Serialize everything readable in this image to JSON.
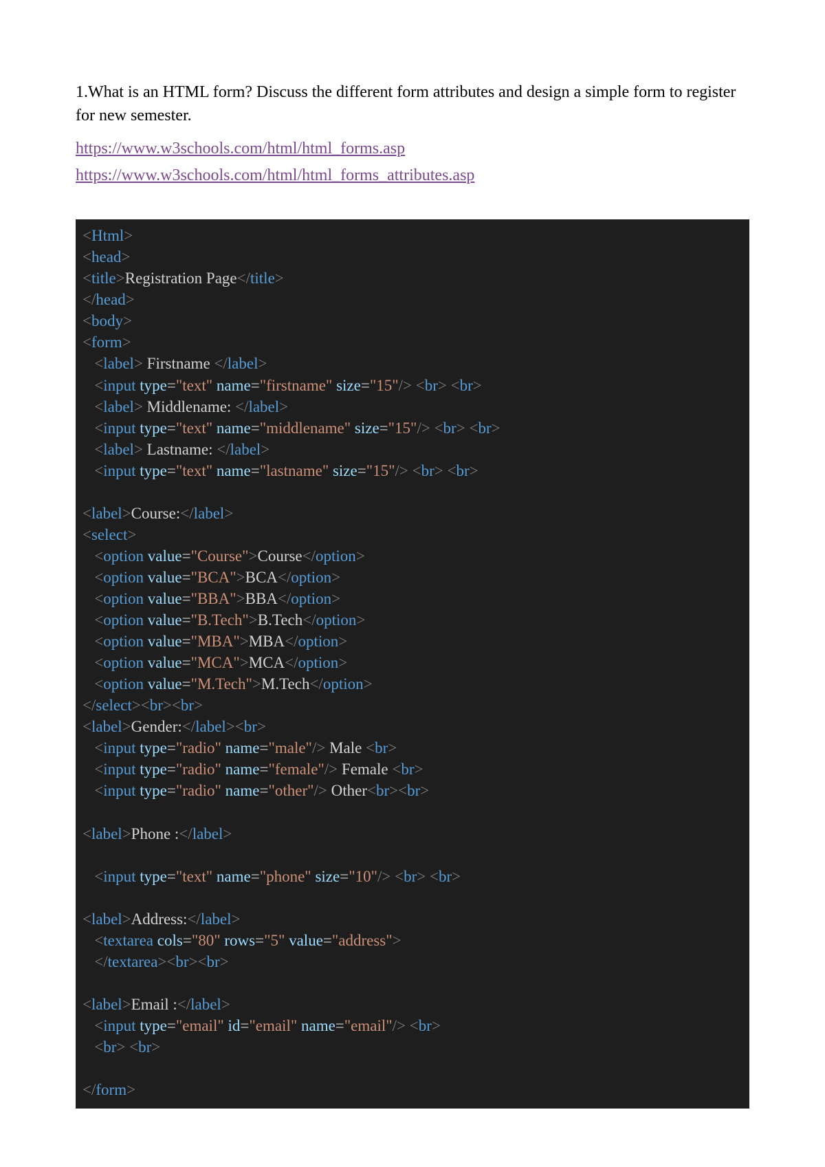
{
  "question": "1.What is an HTML form? Discuss the different form attributes and design a simple form to register for new semester.",
  "links": [
    "https://www.w3schools.com/html/html_forms.asp",
    "https://www.w3schools.com/html/html_forms_attributes.asp"
  ],
  "code": {
    "title_text": "Registration Page",
    "label_firstname": " Firstname ",
    "label_middlename": " Middlename: ",
    "label_lastname": " Lastname: ",
    "label_course": "Course:",
    "label_gender": "Gender:",
    "label_phone": "Phone :",
    "label_address": "Address:",
    "label_email": "Email :",
    "opt_course": "Course",
    "opt_bca": "BCA",
    "opt_bba": "BBA",
    "opt_btech": "B.Tech",
    "opt_mba": "MBA",
    "opt_mca": "MCA",
    "opt_mtech": "M.Tech",
    "gender_male": " Male ",
    "gender_female": " Female ",
    "gender_other": " Other",
    "attr": {
      "text": "\"text\"",
      "radio": "\"radio\"",
      "email": "\"email\"",
      "firstname": "\"firstname\"",
      "middlename": "\"middlename\"",
      "lastname": "\"lastname\"",
      "phone_name": "\"phone\"",
      "email_name": "\"email\"",
      "email_id": "\"email\"",
      "male": "\"male\"",
      "female": "\"female\"",
      "other": "\"other\"",
      "size15": "\"15\"",
      "size10": "\"10\"",
      "cols80": "\"80\"",
      "rows5": "\"5\"",
      "address": "\"address\"",
      "v_course": "\"Course\"",
      "v_bca": "\"BCA\"",
      "v_bba": "\"BBA\"",
      "v_btech": "\"B.Tech\"",
      "v_mba": "\"MBA\"",
      "v_mca": "\"MCA\"",
      "v_mtech": "\"M.Tech\""
    }
  }
}
